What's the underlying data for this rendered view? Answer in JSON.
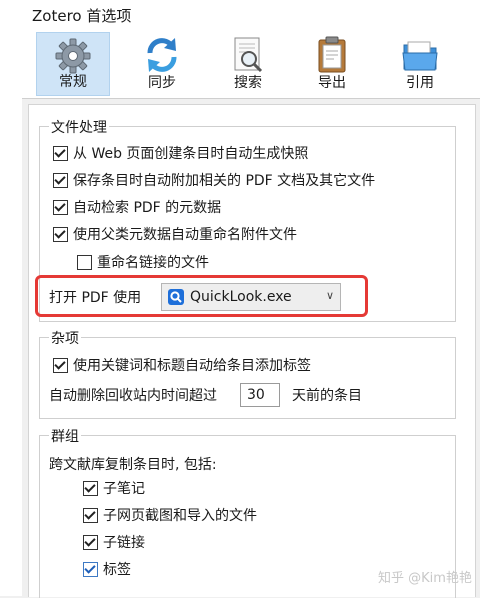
{
  "window": {
    "title": "Zotero 首选项"
  },
  "toolbar": {
    "tabs": [
      {
        "label": "常规",
        "icon": "gear-icon",
        "selected": true
      },
      {
        "label": "同步",
        "icon": "sync-icon",
        "selected": false
      },
      {
        "label": "搜索",
        "icon": "search-document-icon",
        "selected": false
      },
      {
        "label": "导出",
        "icon": "clipboard-icon",
        "selected": false
      },
      {
        "label": "引用",
        "icon": "folder-icon",
        "selected": false
      }
    ]
  },
  "file_handling": {
    "title": "文件处理",
    "options": [
      {
        "label": "从 Web 页面创建条目时自动生成快照",
        "checked": true
      },
      {
        "label": "保存条目时自动附加相关的 PDF 文档及其它文件",
        "checked": true
      },
      {
        "label": "自动检索 PDF 的元数据",
        "checked": true
      },
      {
        "label": "使用父类元数据自动重命名附件文件",
        "checked": true
      },
      {
        "label": "重命名链接的文件",
        "checked": false
      }
    ],
    "open_pdf_label": "打开 PDF 使用",
    "open_pdf_value": "QuickLook.exe",
    "highlight_color": "#e53935"
  },
  "misc": {
    "title": "杂项",
    "auto_tag_label": "使用关键词和标题自动给条目添加标签",
    "auto_tag_checked": true,
    "trash_prefix": "自动删除回收站内时间超过",
    "trash_days": "30",
    "trash_suffix": "天前的条目"
  },
  "groups": {
    "title": "群组",
    "copy_label": "跨文献库复制条目时, 包括:",
    "options": [
      {
        "label": "子笔记",
        "checked": true
      },
      {
        "label": "子网页截图和导入的文件",
        "checked": true
      },
      {
        "label": "子链接",
        "checked": true
      },
      {
        "label": "标签",
        "checked": true
      }
    ]
  },
  "watermark": "知乎 @Kim艳艳",
  "colors": {
    "selected_tab": "#cfe4f7",
    "window_bg": "#f0f0f0"
  }
}
